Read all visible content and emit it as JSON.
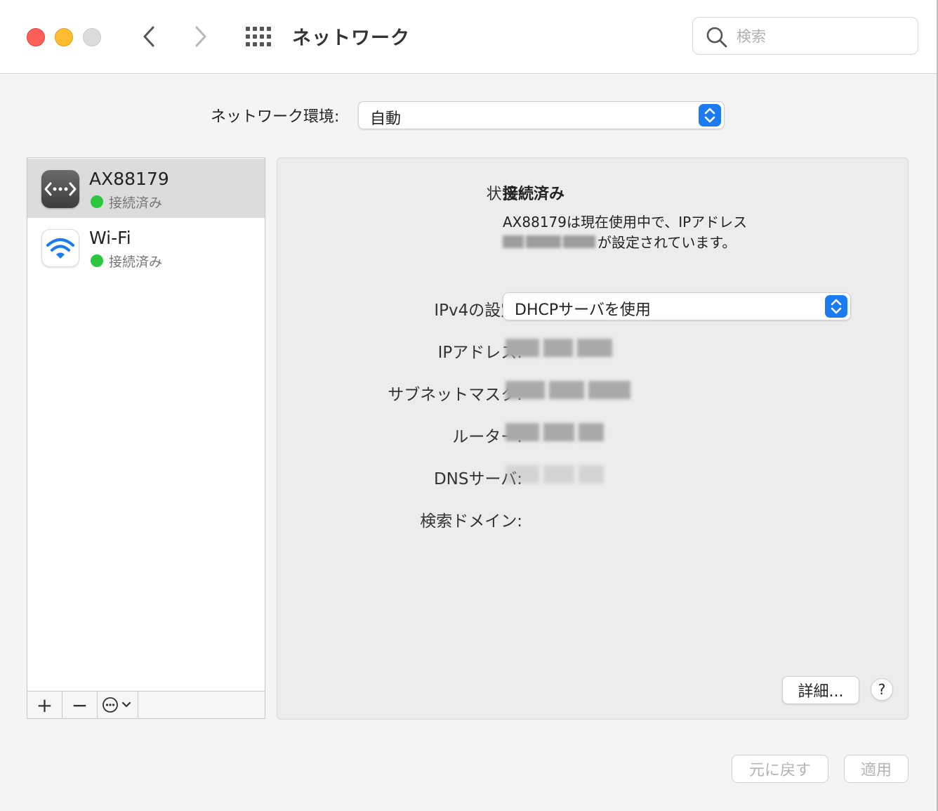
{
  "window": {
    "title": "ネットワーク",
    "search_placeholder": "検索"
  },
  "location": {
    "label": "ネットワーク環境:",
    "value": "自動"
  },
  "services": [
    {
      "name": "AX88179",
      "status": "接続済み",
      "icon": "ethernet-icon",
      "selected": true
    },
    {
      "name": "Wi-Fi",
      "status": "接続済み",
      "icon": "wifi-icon",
      "selected": false
    }
  ],
  "sidebar_toolbar": {
    "add": "+",
    "remove": "−",
    "action": "action-menu-icon"
  },
  "detail": {
    "status_label": "状況:",
    "status_value": "接続済み",
    "description_line1": "AX88179は現在使用中で、IPアドレス",
    "description_line2": "が設定されています。",
    "ipv4_label": "IPv4の設定:",
    "ipv4_value": "DHCPサーバを使用",
    "ip_label": "IPアドレス:",
    "subnet_label": "サブネットマスク:",
    "router_label": "ルーター:",
    "dns_label": "DNSサーバ:",
    "search_domain_label": "検索ドメイン:",
    "advanced_button": "詳細...",
    "help_button": "?"
  },
  "footer": {
    "revert_button": "元に戻す",
    "apply_button": "適用"
  },
  "colors": {
    "accent": "#1a7cf0",
    "connected": "#29c840",
    "close": "#fe5f57",
    "minimize": "#febc2e"
  }
}
